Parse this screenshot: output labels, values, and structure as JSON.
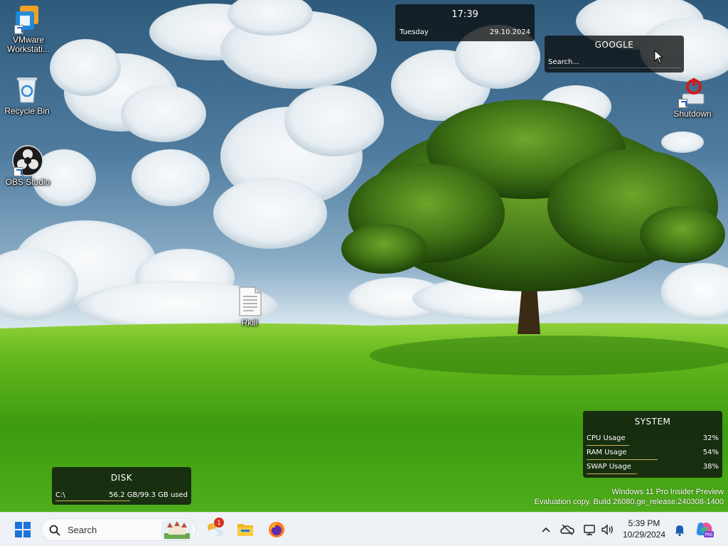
{
  "desktop": {
    "icons": [
      {
        "id": "vmware",
        "label": "VMware Workstati..."
      },
      {
        "id": "recycle",
        "label": "Recycle Bin"
      },
      {
        "id": "obs",
        "label": "OBS Studio"
      },
      {
        "id": "rkill",
        "label": "Rkill"
      },
      {
        "id": "shutdown",
        "label": "Shutdown"
      }
    ]
  },
  "widgets": {
    "clock": {
      "time": "17:39",
      "day": "Tuesday",
      "date": "29.10.2024"
    },
    "google": {
      "title": "GOOGLE",
      "placeholder": "Search..."
    },
    "system": {
      "title": "SYSTEM",
      "rows": [
        {
          "label": "CPU Usage",
          "value": "32%",
          "fraction": 0.32
        },
        {
          "label": "RAM Usage",
          "value": "54%",
          "fraction": 0.54
        },
        {
          "label": "SWAP Usage",
          "value": "38%",
          "fraction": 0.38
        }
      ]
    },
    "disk": {
      "title": "DISK",
      "drive": "C:\\",
      "usage": "56.2 GB/99.3 GB used",
      "fraction": 0.566
    }
  },
  "watermark": {
    "line1": "Windows 11 Pro Insider Preview",
    "line2": "Evaluation copy. Build 26080.ge_release.240308-1400"
  },
  "taskbar": {
    "search_label": "Search",
    "weather_badge": "1",
    "clock_time": "5:39 PM",
    "clock_date": "10/29/2024",
    "icons": [
      "windows-start-icon",
      "search-icon",
      "weather-icon",
      "file-explorer-icon",
      "firefox-icon",
      "chevron-up-icon",
      "onedrive-icon",
      "network-icon",
      "volume-icon",
      "bell-icon",
      "copilot-icon"
    ]
  },
  "colors": {
    "widget_bg": "#0c0e0e",
    "bar_accent": "#c7b25a",
    "taskbar_bg": "#eef1f5"
  }
}
